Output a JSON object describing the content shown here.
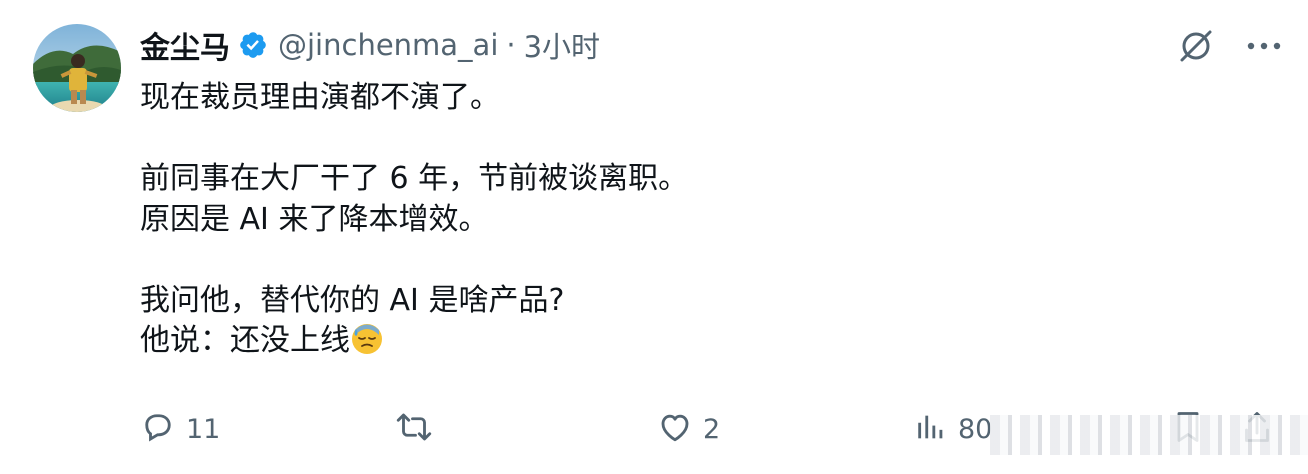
{
  "author": {
    "display_name": "金尘马",
    "handle": "@jinchenma_ai",
    "separator": "·",
    "time_ago": "3小时"
  },
  "icons": {
    "verified": "verified-badge-icon",
    "grok": "grok-icon",
    "more": "more-icon",
    "reply": "reply-icon",
    "retweet": "retweet-icon",
    "like": "like-icon",
    "views": "views-icon",
    "bookmark": "bookmark-icon",
    "share": "share-icon",
    "emoji": "sweat-emoji-icon"
  },
  "colors": {
    "verified_blue": "#1d9bf0",
    "text_primary": "#0f1419",
    "text_secondary": "#536471"
  },
  "tweet": {
    "lines": [
      "现在裁员理由演都不演了。",
      "",
      "前同事在大厂干了 6 年，节前被谈离职。",
      "原因是 AI 来了降本增效。",
      "",
      "我问他，替代你的 AI 是啥产品?",
      "他说：还没上线"
    ]
  },
  "actions": {
    "reply_count": "11",
    "retweet_count": "",
    "like_count": "2",
    "views_count": "80"
  }
}
